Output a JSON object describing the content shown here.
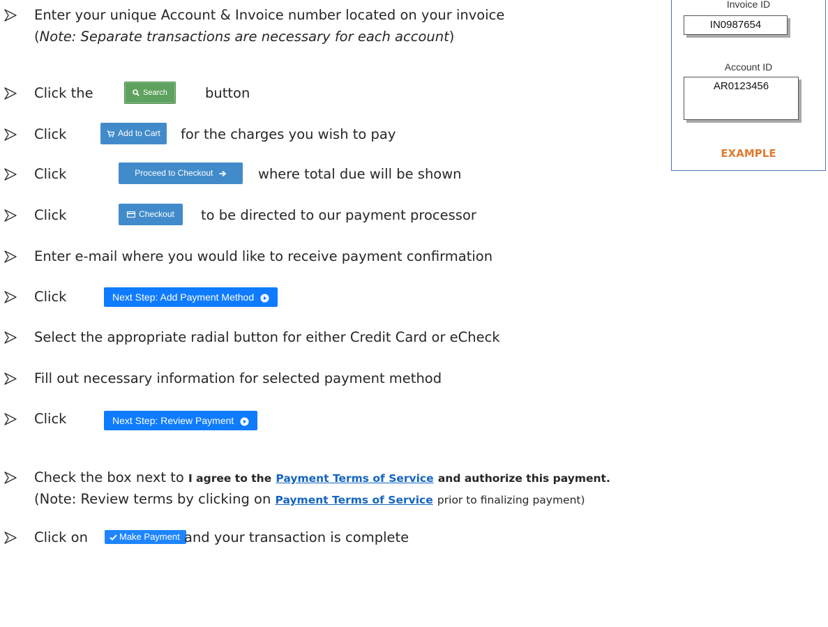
{
  "steps": {
    "s1_line1": "Enter your unique Account & Invoice number located on your invoice",
    "s1_line2_open": "(",
    "s1_note": "Note: Separate transactions are necessary for each account",
    "s1_line2_close": ")",
    "s2_pre": "Click the",
    "s2_post": "button",
    "s3_pre": "Click",
    "s3_post": "for the charges you wish to pay",
    "s4_pre": "Click",
    "s4_post": "where total due will be shown",
    "s5_pre": "Click",
    "s5_post": "to be directed to our payment processor",
    "s6": "Enter e-mail where you would like to receive payment confirmation",
    "s7_pre": "Click",
    "s8": "Select the appropriate radial button for either Credit Card or eCheck",
    "s9": "Fill out necessary information for selected payment method",
    "s10_pre": "Click",
    "s11_pre": "Check the box next to",
    "s11_bold1": "I agree to the",
    "s11_link": "Payment Terms of Service",
    "s11_bold2": "and authorize this payment.",
    "s11_note_pre": "(Note: Review terms by clicking on",
    "s11_note_link": "Payment Terms of Service",
    "s11_note_post": "prior to finalizing payment)",
    "s12_pre": "Click on",
    "s12_post": "and your transaction is complete"
  },
  "buttons": {
    "search": "Search",
    "add_to_cart": "Add to Cart",
    "proceed": "Proceed to Checkout",
    "checkout": "Checkout",
    "next_payment_method": "Next Step: Add Payment Method",
    "next_review": "Next Step: Review Payment",
    "make_payment": "Make Payment"
  },
  "example": {
    "invoice_label": "Invoice ID",
    "invoice_value": "IN0987654",
    "account_label": "Account ID",
    "account_value": "AR0123456",
    "footer": "EXAMPLE"
  },
  "colors": {
    "search_green": "#5fa25f",
    "bootstrap_blue": "#428bca",
    "bright_blue": "#0f7bff",
    "link_blue": "#1565c0",
    "example_orange": "#e07b31"
  },
  "icons": {
    "bullet": "arrowhead-bullet-icon",
    "search": "magnifier-icon",
    "cart": "cart-icon",
    "proceed": "arrow-right-icon",
    "checkout": "credit-card-icon",
    "next": "circle-play-icon",
    "make_payment": "checkmark-icon"
  }
}
